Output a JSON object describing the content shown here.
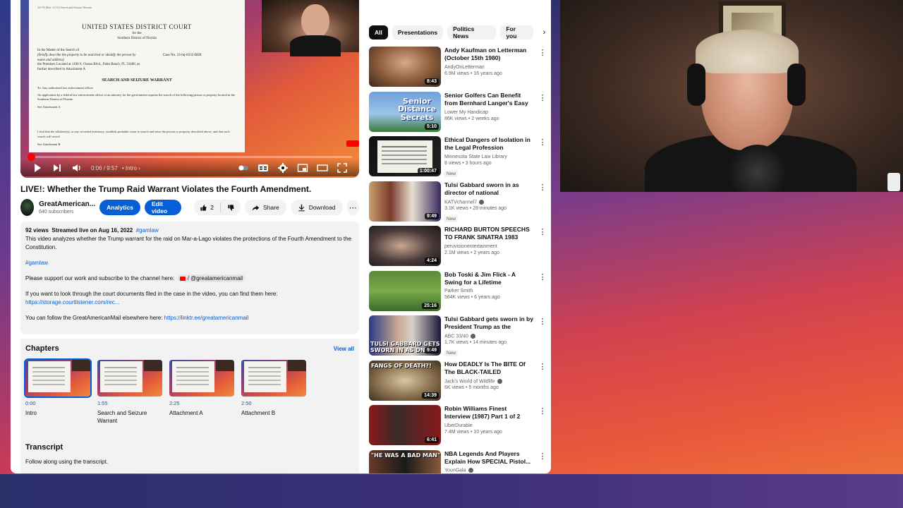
{
  "video": {
    "title": "LIVE!: Whether the Trump Raid Warrant Violates the Fourth Amendment.",
    "time_current": "0:06",
    "time_total": "9:57",
    "time_separator": "/",
    "chapter_label": "Intro",
    "progress_fraction": 0.011
  },
  "document": {
    "header_small": "AO 93 (Rev. 11/13) Search and Seizure Warrant",
    "court": "UNITED STATES DISTRICT COURT",
    "for": "for the",
    "district": "Southern District of Florida",
    "matter_line1": "In the Matter of the Search of",
    "matter_line2": "(Briefly describe the property to be searched or identify the person by name and address)",
    "matter_line3": "the Premises Located at 1100 S. Ocean Blvd., Palm Beach, FL 33480, as further described in Attachment A",
    "case_no": "Case No.   22-mj-8332-BER",
    "warrant_title": "SEARCH AND SEIZURE WARRANT",
    "to_line": "To:   Any authorized law enforcement officer",
    "application": "An application by a federal law enforcement officer or an attorney for the government requests the search of the following person or property located in the   Southern   District of   Florida",
    "see_a": "See Attachment A",
    "finding": "I find that the affidavit(s), or any recorded testimony, establish probable cause to search and seize the person or property described above, and that such search will reveal",
    "see_b": "See Attachment B"
  },
  "channel": {
    "name": "GreatAmerican...",
    "subscribers": "640 subscribers",
    "analytics_label": "Analytics",
    "edit_label": "Edit video",
    "like_count": "2",
    "share_label": "Share",
    "download_label": "Download"
  },
  "description": {
    "views": "92 views",
    "streamed": "Streamed live on Aug 16, 2022",
    "hashtag": "#gamlaw",
    "summary": "This video analyzes whether the Trump warrant for the raid on Mar-a-Lago violates the protections of the Fourth Amendment to the Constitution.",
    "hashtag2": "#gamlaw",
    "support_text": "Please support our work and subscribe to the channel here:",
    "channel_ref": "/ @greatamericanmail",
    "court_docs_text": "If you want to look through the court documents filed in the case in the video, you can find them here:",
    "court_docs_link": "https://storage.courtlistener.com/rec...",
    "follow_text": "You can follow the GreatAmericanMail elsewhere here:",
    "follow_link": "https://linktr.ee/greatamericanmail"
  },
  "chapters": {
    "heading": "Chapters",
    "view_all": "View all",
    "items": [
      {
        "time": "0:00",
        "title": "Intro"
      },
      {
        "time": "1:55",
        "title": "Search and Seizure Warrant"
      },
      {
        "time": "2:25",
        "title": "Attachment A"
      },
      {
        "time": "2:50",
        "title": "Attachment B"
      }
    ]
  },
  "transcript": {
    "heading": "Transcript",
    "subtitle": "Follow along using the transcript."
  },
  "chips": [
    "All",
    "Presentations",
    "Politics News",
    "For you"
  ],
  "recommendations": [
    {
      "title": "Andy Kaufman on Letterman (October 15th 1980)",
      "channel": "AndyOnLetterman",
      "meta": "6.9M views • 16 years ago",
      "duration": "8:43",
      "verified": false,
      "new": ""
    },
    {
      "title": "Senior Golfers Can Benefit from Bernhard Langer's Easy Driver...",
      "channel": "Lower My Handicap",
      "meta": "86K views • 2 weeks ago",
      "duration": "5:10",
      "verified": false,
      "new": "",
      "thumb_text": "Senior Distance Secrets"
    },
    {
      "title": "Ethical Dangers of Isolation in the Legal Profession",
      "channel": "Minnesota State Law Library",
      "meta": "8 views • 3 hours ago",
      "duration": "1:00:47",
      "verified": false,
      "new": "New"
    },
    {
      "title": "Tulsi Gabbard sworn in as director of national intelligence",
      "channel": "KATVchannel7",
      "meta": "3.1K views • 28 minutes ago",
      "duration": "9:49",
      "verified": true,
      "new": "New"
    },
    {
      "title": "RICHARD BURTON SPEECHS TO FRANK SINATRA 1983",
      "channel": "peruvisionentertainment",
      "meta": "2.1M views • 2 years ago",
      "duration": "4:24",
      "verified": false,
      "new": ""
    },
    {
      "title": "Bob Toski & Jim Flick - A Swing for a Lifetime",
      "channel": "Parker Smith",
      "meta": "564K views • 6 years ago",
      "duration": "25:16",
      "verified": false,
      "new": ""
    },
    {
      "title": "Tulsi Gabbard gets sworn in by President Trump as the Direct...",
      "channel": "ABC 33/40",
      "meta": "1.7K views • 14 minutes ago",
      "duration": "9:49",
      "verified": true,
      "new": "New",
      "thumb_text": "TULSI GABBARD GETS SWORN IN AS DNI"
    },
    {
      "title": "How DEADLY Is The BITE Of The BLACK-TAILED RATTLESNAKE!?",
      "channel": "Jack's World of Wildlife",
      "meta": "6K views • 5 months ago",
      "duration": "14:39",
      "verified": true,
      "new": "",
      "thumb_text": "FANGS OF DEATH?!"
    },
    {
      "title": "Robin Williams Finest Interview (1987) Part 1 of 2",
      "channel": "UberDurable",
      "meta": "7.4M views • 10 years ago",
      "duration": "6:41",
      "verified": false,
      "new": ""
    },
    {
      "title": "NBA Legends And Players Explain How SPECIAL Pistol...",
      "channel": "YounGala",
      "meta": "",
      "duration": "",
      "verified": true,
      "new": "",
      "thumb_text": "\"HE WAS A BAD MAN\""
    }
  ]
}
